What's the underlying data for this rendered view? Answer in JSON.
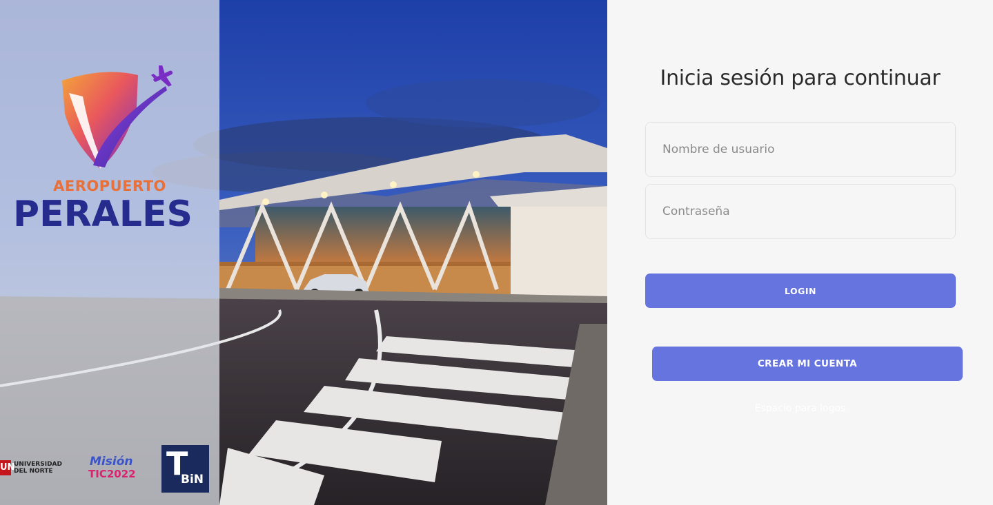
{
  "brand": {
    "top_word": "AEROPUERTO",
    "main_word": "PERALES",
    "colors": {
      "top_word": "#e8703a",
      "main_word": "#262c8e"
    }
  },
  "partner_logos": {
    "un": {
      "mark": "UN",
      "line1": "UNIVERSIDAD",
      "line2": "DEL NORTE"
    },
    "mision": {
      "line1": "Misión",
      "line2": "TIC2022"
    },
    "tbin": {
      "mark": "T",
      "sub": "BiN"
    }
  },
  "login": {
    "title": "Inicia sesión para continuar",
    "username_placeholder": "Nombre de usuario",
    "password_placeholder": "Contraseña",
    "login_label": "LOGIN",
    "create_label": "CREAR MI CUENTA",
    "logos_space_text": "Espacio para logos"
  },
  "colors": {
    "button": "#6674e0",
    "panel_bg": "#f6f6f6",
    "title_text": "#2b2b2b"
  }
}
